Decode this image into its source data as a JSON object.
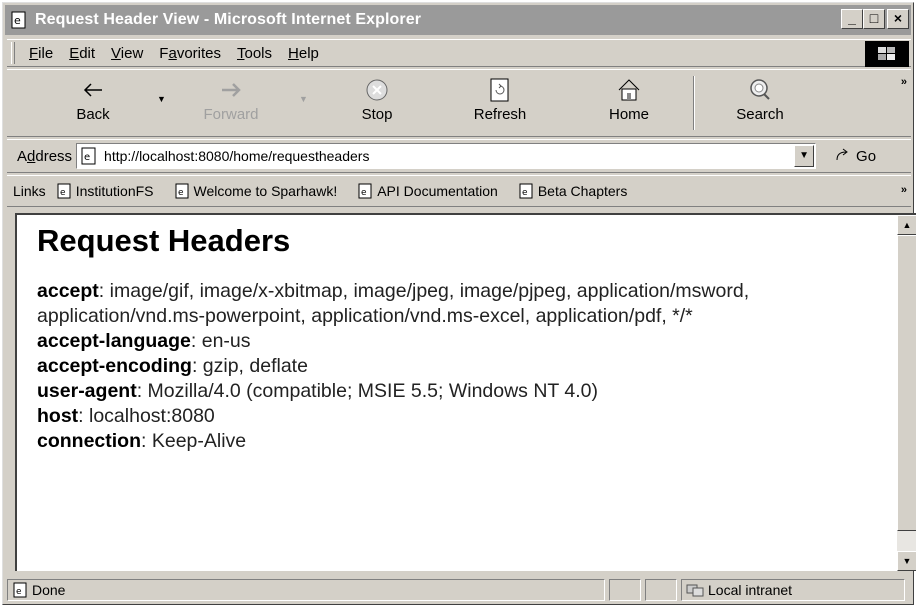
{
  "window": {
    "title": "Request Header View - Microsoft Internet Explorer",
    "controls": {
      "minimize": "_",
      "maximize": "□",
      "close": "×"
    }
  },
  "menu": [
    "File",
    "Edit",
    "View",
    "Favorites",
    "Tools",
    "Help"
  ],
  "menu_accel": [
    "F",
    "E",
    "V",
    "a",
    "T",
    "H"
  ],
  "toolbar": {
    "back": "Back",
    "forward": "Forward",
    "stop": "Stop",
    "refresh": "Refresh",
    "home": "Home",
    "search": "Search",
    "more": "»"
  },
  "address": {
    "label": "Address",
    "url": "http://localhost:8080/home/requestheaders",
    "go": "Go"
  },
  "links": {
    "label": "Links",
    "items": [
      "InstitutionFS",
      "Welcome to Sparhawk!",
      "API Documentation",
      "Beta Chapters"
    ],
    "more": "»"
  },
  "page": {
    "heading": "Request Headers",
    "headers": [
      {
        "name": "accept",
        "value": ": image/gif, image/x-xbitmap, image/jpeg, image/pjpeg, application/msword, application/vnd.ms-powerpoint, application/vnd.ms-excel, application/pdf, */*"
      },
      {
        "name": "accept-language",
        "value": ": en-us"
      },
      {
        "name": "accept-encoding",
        "value": ": gzip, deflate"
      },
      {
        "name": "user-agent",
        "value": ": Mozilla/4.0 (compatible; MSIE 5.5; Windows NT 4.0)"
      },
      {
        "name": "host",
        "value": ": localhost:8080"
      },
      {
        "name": "connection",
        "value": ": Keep-Alive"
      }
    ]
  },
  "status": {
    "text": "Done",
    "zone": "Local intranet"
  }
}
